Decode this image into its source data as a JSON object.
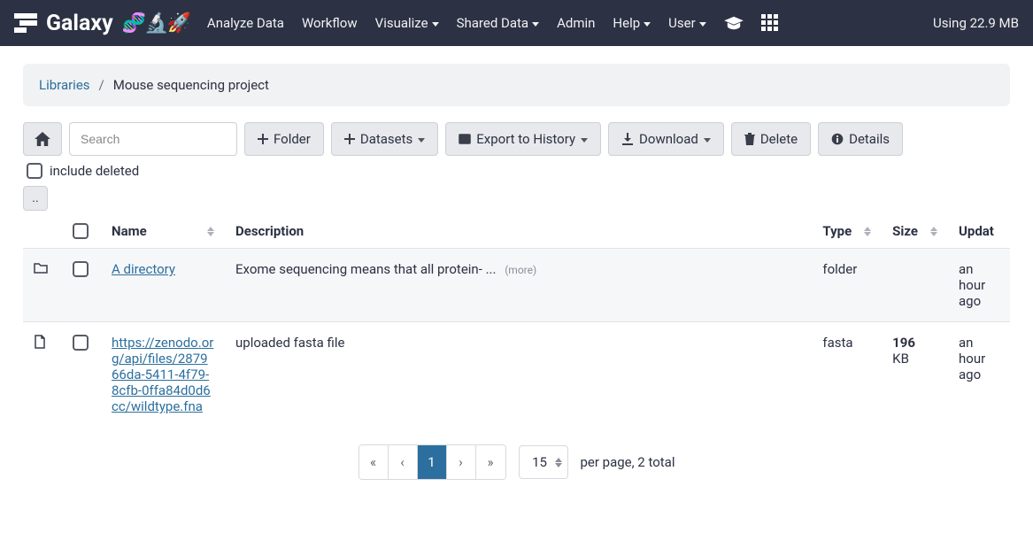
{
  "nav": {
    "brand_title": "Galaxy",
    "brand_emoji": "🧬🔬🚀",
    "links": {
      "analyze": "Analyze Data",
      "workflow": "Workflow",
      "visualize": "Visualize",
      "shared_data": "Shared Data",
      "admin": "Admin",
      "help": "Help",
      "user": "User"
    },
    "usage": "Using 22.9 MB"
  },
  "breadcrumb": {
    "root": "Libraries",
    "sep": "/",
    "current": "Mouse sequencing project"
  },
  "toolbar": {
    "search_placeholder": "Search",
    "folder": "Folder",
    "datasets": "Datasets",
    "export": "Export to History",
    "download": "Download",
    "delete": "Delete",
    "details": "Details",
    "include_deleted": "include deleted",
    "up_label": ".."
  },
  "table": {
    "headers": {
      "name": "Name",
      "description": "Description",
      "type": "Type",
      "size": "Size",
      "updated": "Updat"
    },
    "rows": [
      {
        "kind": "folder",
        "name": "A directory",
        "desc": "Exome sequencing means that all protein- ...",
        "desc_more": "(more)",
        "type": "folder",
        "size_bold": "",
        "size_rest": "",
        "updated": "an hour ago"
      },
      {
        "kind": "file",
        "name": "https://zenodo.org/api/files/287966da-5411-4f79-8cfb-0ffa84d0d6cc/wildtype.fna",
        "desc": "uploaded fasta file",
        "desc_more": "",
        "type": "fasta",
        "size_bold": "196",
        "size_rest": "KB",
        "updated": "an hour ago"
      }
    ]
  },
  "pagination": {
    "first": "«",
    "prev": "‹",
    "page": "1",
    "next": "›",
    "last": "»",
    "per_page_value": "15",
    "suffix": "per page, 2 total"
  }
}
